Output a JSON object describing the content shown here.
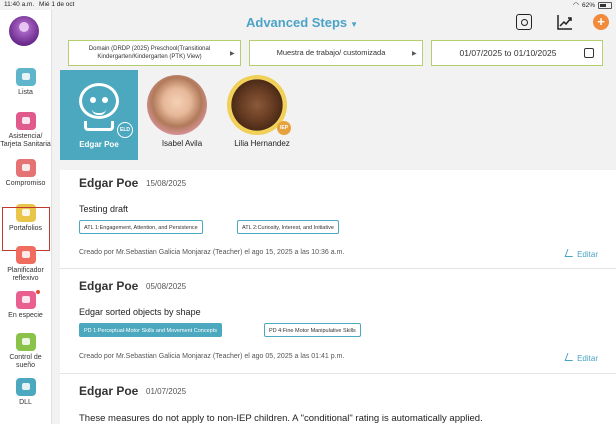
{
  "status": {
    "time": "11:40 a.m.",
    "date": "Mié 1 de oct",
    "battery": "62%"
  },
  "header": {
    "title": "Advanced Steps"
  },
  "filters": {
    "domain": "Domain (DRDP (2025) Preschool(Transitional Kindergarten/Kindergarten (PTK) View)",
    "sample": "Muestra de trabajo/ customizada",
    "date_range": "01/07/2025 to 01/10/2025"
  },
  "sidebar": {
    "items": [
      {
        "label": "Lista",
        "color": "#5fb5c9"
      },
      {
        "label": "Asistencia/ Tarjeta Sanitaria",
        "color": "#e05a8c"
      },
      {
        "label": "Compromiso",
        "color": "#e57373"
      },
      {
        "label": "Portafolios",
        "color": "#e9c54a"
      },
      {
        "label": "Planificador reflexivo",
        "color": "#ef6c5e"
      },
      {
        "label": "En especie",
        "color": "#e96090"
      },
      {
        "label": "Control de sueño",
        "color": "#8bc34a"
      },
      {
        "label": "DLL",
        "color": "#4ca8be"
      }
    ]
  },
  "students": [
    {
      "name": "Edgar Poe",
      "badge": "ELD"
    },
    {
      "name": "Isabel Avila",
      "badge": ""
    },
    {
      "name": "Lilia Hernandez",
      "badge": "IEP"
    }
  ],
  "entries": [
    {
      "author": "Edgar Poe",
      "date": "15/08/2025",
      "text": "Testing draft",
      "tags": [
        "ATL 1:Engagement, Attention, and Persistence",
        "ATL 2:Curiosity, Interest, and Initiative"
      ],
      "creator": "Creado por Mr.Sebastian Galicia Monjaraz (Teacher) el ago 15, 2025 a las 10:36 a.m.",
      "edit": "Editar"
    },
    {
      "author": "Edgar Poe",
      "date": "05/08/2025",
      "text": "Edgar sorted objects by shape",
      "tags": [
        "PD 1:Perceptual-Motor Skills and Movement Concepts",
        "PD 4:Fine Motor Manipulative Skills"
      ],
      "creator": "Creado por Mr.Sebastian Galicia Monjaraz (Teacher) el ago 05, 2025 a las 01:41 p.m.",
      "edit": "Editar"
    },
    {
      "author": "Edgar Poe",
      "date": "01/07/2025",
      "text": "These measures do not apply to non-IEP children. A \"conditional\" rating is automatically applied."
    }
  ],
  "colors": {
    "accent": "#4ba3c7",
    "selected": "#4ca8be",
    "filter_border": "#b6cf6e",
    "add": "#f08a3c"
  }
}
